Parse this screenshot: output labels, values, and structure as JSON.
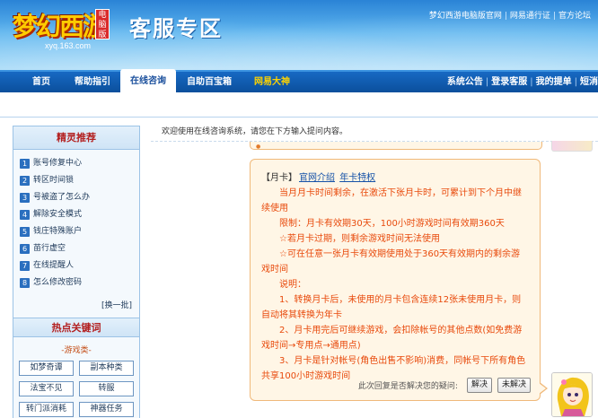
{
  "header": {
    "logo_text": "梦幻西游",
    "logo_badge": "电脑版",
    "logo_url": "xyq.163.com",
    "title": "客服专区",
    "top_links": [
      "梦幻西游电脑版官网",
      "网易通行证",
      "官方论坛"
    ]
  },
  "nav": {
    "items": [
      "首页",
      "帮助指引",
      "在线咨询",
      "自助百宝箱",
      "网易大神"
    ],
    "active": "在线咨询",
    "right_links": [
      "系统公告",
      "登录客服",
      "我的提单",
      "短消"
    ]
  },
  "sidebar": {
    "title": "精灵推荐",
    "items": [
      {
        "num": "1",
        "label": "账号修复中心"
      },
      {
        "num": "2",
        "label": "转区时间锁"
      },
      {
        "num": "3",
        "label": "号被盗了怎么办"
      },
      {
        "num": "4",
        "label": "解除安全模式"
      },
      {
        "num": "5",
        "label": "钱庄特殊账户"
      },
      {
        "num": "6",
        "label": "苗行虚空"
      },
      {
        "num": "7",
        "label": "在线提醒人"
      },
      {
        "num": "8",
        "label": "怎么修改密码"
      }
    ],
    "more_label": "[换一批]",
    "keywords_title": "热点关键词",
    "game_type": "-游戏类-",
    "keywords": [
      "如梦奇谭",
      "副本种类",
      "法宝不见",
      "转服",
      "转门派消耗",
      "神器任务"
    ]
  },
  "main": {
    "welcome": "欢迎使用在线咨询系统，请您在下方输入提问内容。",
    "answer": {
      "head_tag": "【月卡】",
      "link1": "官网介绍",
      "link2": "年卡特权",
      "lines": [
        "当月月卡时间剩余，在激活下张月卡时，可累计到下个月中继续使用",
        "限制：月卡有效期30天，100小时游戏时间有效期360天",
        "☆若月卡过期，则剩余游戏时间无法使用",
        "☆可在任意一张月卡有效期使用处于360天有效期内的剩余游戏时间",
        "说明：",
        "1、转换月卡后，未使用的月卡包含连续12张未使用月卡，则自动将其转换为年卡",
        "2、月卡用完后可继续游戏，会扣除帐号的其他点数(如免费游戏时间→专用点→通用点)",
        "3、月卡是针对帐号(角色出售不影响)消费，同帐号下所有角色共享100小时游戏时间"
      ]
    },
    "feedback_label": "此次回复是否解决您的疑问:",
    "solved_button": "解决",
    "unsolved_button": "未解决"
  },
  "colors": {
    "nav_bg": "#0b4f9c",
    "answer_text": "#e84a0c",
    "bubble_bg": "#fff6e6",
    "bubble_border": "#f0b97a",
    "sidebar_title": "#b32020"
  }
}
